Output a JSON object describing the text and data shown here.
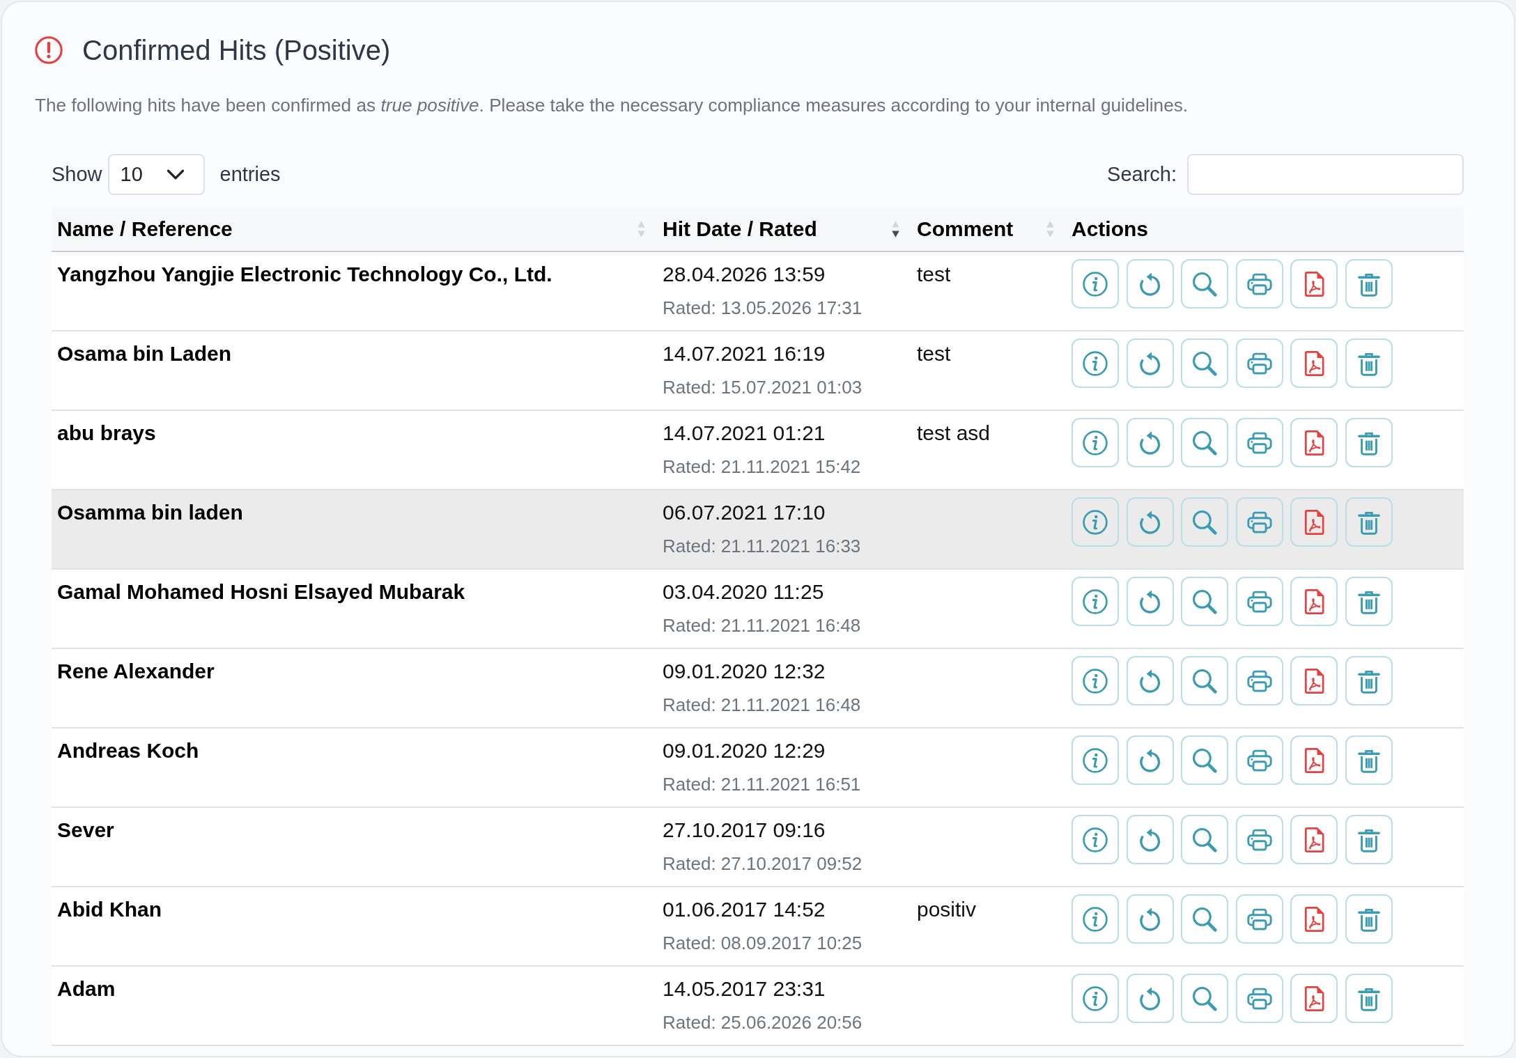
{
  "header": {
    "title": "Confirmed Hits (Positive)"
  },
  "description": "The following hits have been confirmed as *true positive*. Please take the necessary compliance measures according to your internal guidelines.",
  "length_control": {
    "label_before": "Show",
    "value": "10",
    "label_after": "entries"
  },
  "search": {
    "label": "Search:"
  },
  "table": {
    "columns": [
      {
        "label": "Name / Reference",
        "sortable": true,
        "sorted": false
      },
      {
        "label": "Hit Date / Rated",
        "sortable": true,
        "sorted": true,
        "descending": true
      },
      {
        "label": "Comment",
        "sortable": true,
        "sorted": false
      },
      {
        "label": "Actions",
        "sortable": false
      }
    ],
    "row_actions": [
      {
        "kind": "info"
      },
      {
        "kind": "undo"
      },
      {
        "kind": "search"
      },
      {
        "kind": "print"
      },
      {
        "kind": "pdf"
      },
      {
        "kind": "delete"
      }
    ],
    "rows": [
      {
        "name": "Yangzhou Yangjie Electronic Technology Co., Ltd.",
        "hit_date": "28.04.2026 13:59",
        "rated": "Rated: 13.05.2026 17:31",
        "comment": "test",
        "highlighted": false
      },
      {
        "name": "Osama bin Laden",
        "hit_date": "14.07.2021 16:19",
        "rated": "Rated: 15.07.2021 01:03",
        "comment": "test",
        "highlighted": false
      },
      {
        "name": "abu brays",
        "hit_date": "14.07.2021 01:21",
        "rated": "Rated: 21.11.2021 15:42",
        "comment": "test asd",
        "highlighted": false
      },
      {
        "name": "Osamma bin laden",
        "hit_date": "06.07.2021 17:10",
        "rated": "Rated: 21.11.2021 16:33",
        "highlighted": true
      },
      {
        "name": "Gamal Mohamed Hosni Elsayed Mubarak",
        "hit_date": "03.04.2020 11:25",
        "rated": "Rated: 21.11.2021 16:48",
        "highlighted": false
      },
      {
        "name": "Rene Alexander",
        "hit_date": "09.01.2020 12:32",
        "rated": "Rated: 21.11.2021 16:48",
        "highlighted": false
      },
      {
        "name": "Andreas Koch",
        "hit_date": "09.01.2020 12:29",
        "rated": "Rated: 21.11.2021 16:51",
        "highlighted": false
      },
      {
        "name": "Sever",
        "hit_date": "27.10.2017 09:16",
        "rated": "Rated: 27.10.2017 09:52",
        "highlighted": false
      },
      {
        "name": "Abid Khan",
        "hit_date": "01.06.2017 14:52",
        "rated": "Rated: 08.09.2017 10:25",
        "comment": "positiv",
        "highlighted": false
      },
      {
        "name": "Adam",
        "hit_date": "14.05.2017 23:31",
        "rated": "Rated: 25.06.2026 20:56",
        "highlighted": false
      }
    ]
  }
}
